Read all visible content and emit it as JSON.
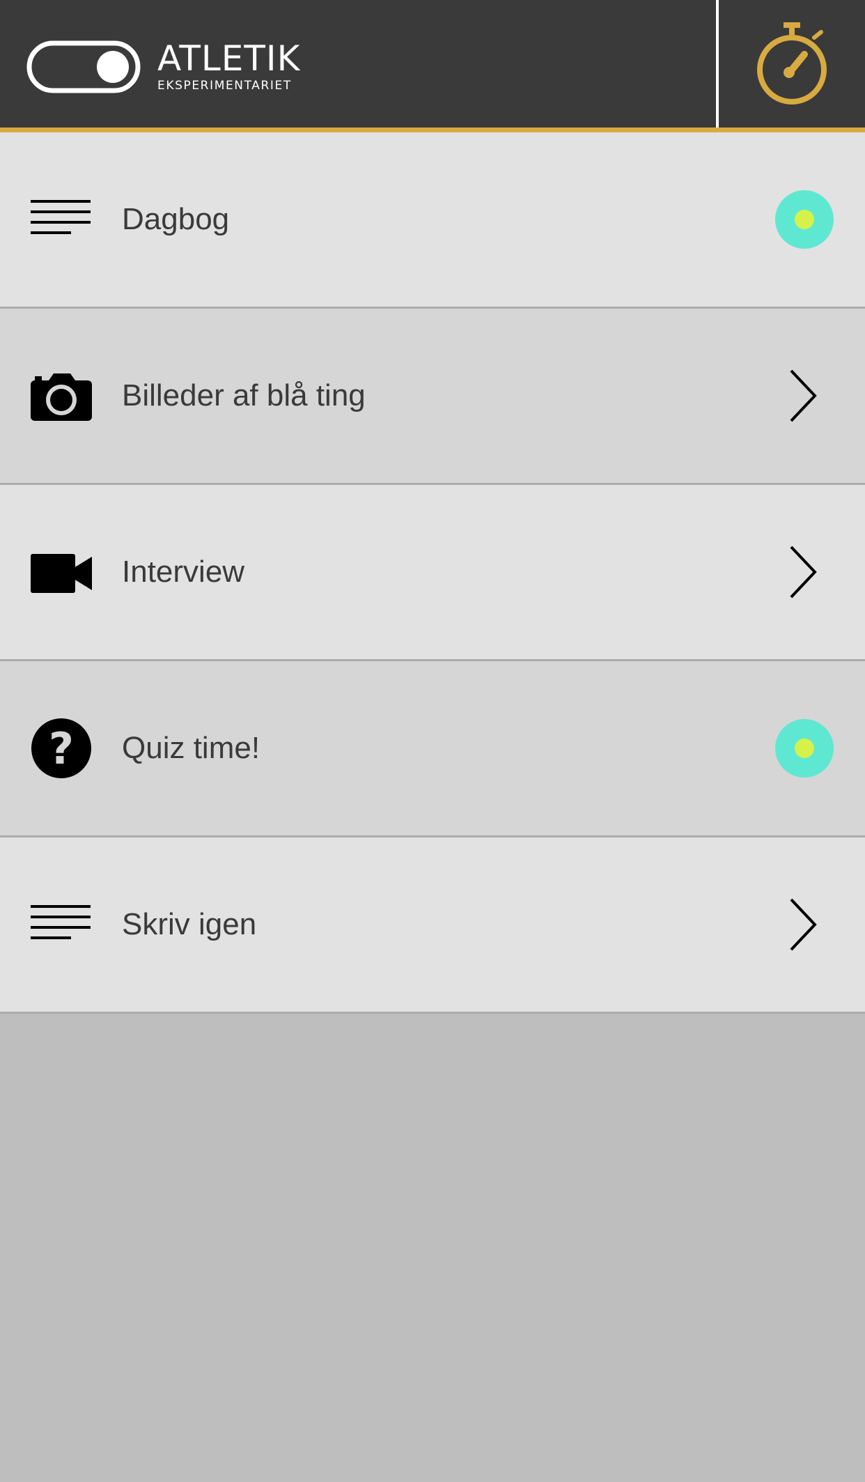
{
  "header": {
    "logo_title": "ATLETIK",
    "logo_subtitle": "EKSPERIMENTARIET",
    "timer_icon": "stopwatch-icon"
  },
  "colors": {
    "header_bg": "#3a3a3a",
    "accent": "#d8ab41",
    "status_outer": "#5ee8d2",
    "status_inner": "#d6f24a"
  },
  "menu": {
    "items": [
      {
        "label": "Dagbog",
        "icon": "text-lines-icon",
        "indicator": "status-dot"
      },
      {
        "label": "Billeder af blå ting",
        "icon": "camera-icon",
        "indicator": "chevron-right"
      },
      {
        "label": "Interview",
        "icon": "video-camera-icon",
        "indicator": "chevron-right"
      },
      {
        "label": "Quiz time!",
        "icon": "question-icon",
        "indicator": "status-dot"
      },
      {
        "label": "Skriv igen",
        "icon": "text-lines-icon",
        "indicator": "chevron-right"
      }
    ]
  }
}
